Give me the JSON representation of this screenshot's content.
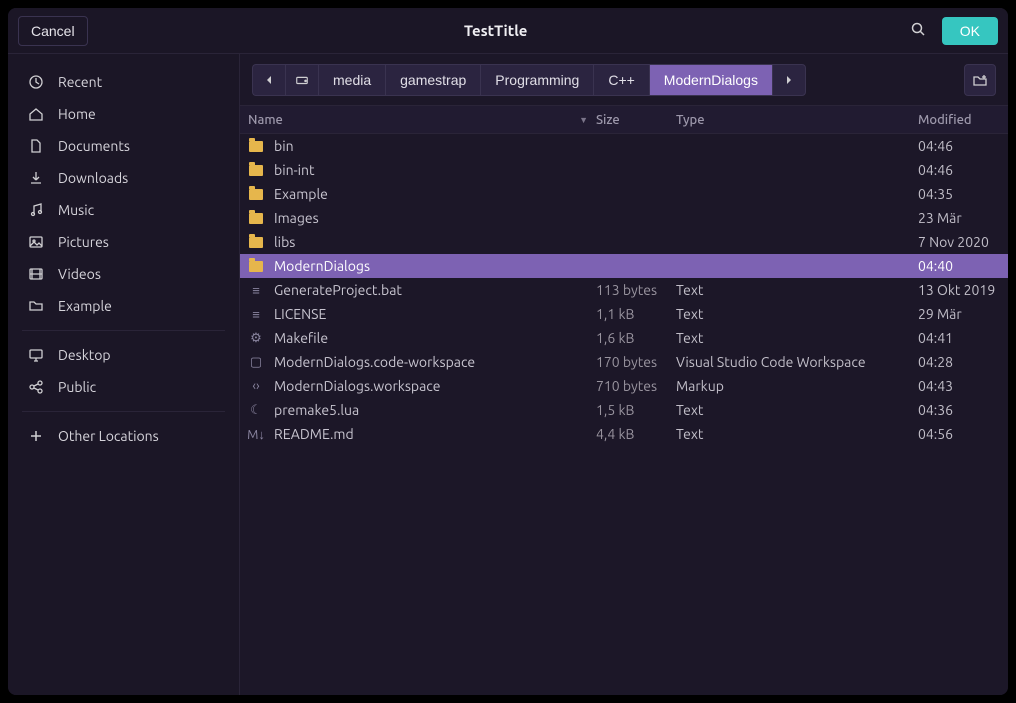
{
  "header": {
    "cancel": "Cancel",
    "title": "TestTitle",
    "ok": "OK"
  },
  "sidebar": {
    "items": [
      {
        "label": "Recent",
        "icon": "clock-icon"
      },
      {
        "label": "Home",
        "icon": "home-icon"
      },
      {
        "label": "Documents",
        "icon": "document-icon"
      },
      {
        "label": "Downloads",
        "icon": "download-icon"
      },
      {
        "label": "Music",
        "icon": "music-icon"
      },
      {
        "label": "Pictures",
        "icon": "picture-icon"
      },
      {
        "label": "Videos",
        "icon": "video-icon"
      },
      {
        "label": "Example",
        "icon": "folder-icon"
      }
    ],
    "drives": [
      {
        "label": "Desktop",
        "icon": "desktop-icon"
      },
      {
        "label": "Public",
        "icon": "share-icon"
      }
    ],
    "other": {
      "label": "Other Locations",
      "icon": "plus-icon"
    }
  },
  "breadcrumb": {
    "segments": [
      {
        "label": "media"
      },
      {
        "label": "gamestrap"
      },
      {
        "label": "Programming"
      },
      {
        "label": "C++"
      },
      {
        "label": "ModernDialogs",
        "active": true
      }
    ]
  },
  "columns": {
    "name": "Name",
    "size": "Size",
    "type": "Type",
    "modified": "Modified"
  },
  "files": [
    {
      "name": "bin",
      "kind": "folder",
      "size": "",
      "type": "",
      "modified": "04:46"
    },
    {
      "name": "bin-int",
      "kind": "folder",
      "size": "",
      "type": "",
      "modified": "04:46"
    },
    {
      "name": "Example",
      "kind": "folder",
      "size": "",
      "type": "",
      "modified": "04:35"
    },
    {
      "name": "Images",
      "kind": "folder",
      "size": "",
      "type": "",
      "modified": "23 Mär"
    },
    {
      "name": "libs",
      "kind": "folder",
      "size": "",
      "type": "",
      "modified": "7 Nov 2020"
    },
    {
      "name": "ModernDialogs",
      "kind": "folder",
      "size": "",
      "type": "",
      "modified": "04:40",
      "selected": true
    },
    {
      "name": "GenerateProject.bat",
      "kind": "text",
      "size": "113 bytes",
      "type": "Text",
      "modified": "13 Okt 2019"
    },
    {
      "name": "LICENSE",
      "kind": "text",
      "size": "1,1 kB",
      "type": "Text",
      "modified": "29 Mär"
    },
    {
      "name": "Makefile",
      "kind": "make",
      "size": "1,6 kB",
      "type": "Text",
      "modified": "04:41"
    },
    {
      "name": "ModernDialogs.code-workspace",
      "kind": "code",
      "size": "170 bytes",
      "type": "Visual Studio Code Workspace",
      "modified": "04:28"
    },
    {
      "name": "ModernDialogs.workspace",
      "kind": "markup",
      "size": "710 bytes",
      "type": "Markup",
      "modified": "04:43"
    },
    {
      "name": "premake5.lua",
      "kind": "lua",
      "size": "1,5 kB",
      "type": "Text",
      "modified": "04:36"
    },
    {
      "name": "README.md",
      "kind": "md",
      "size": "4,4 kB",
      "type": "Text",
      "modified": "04:56"
    }
  ]
}
